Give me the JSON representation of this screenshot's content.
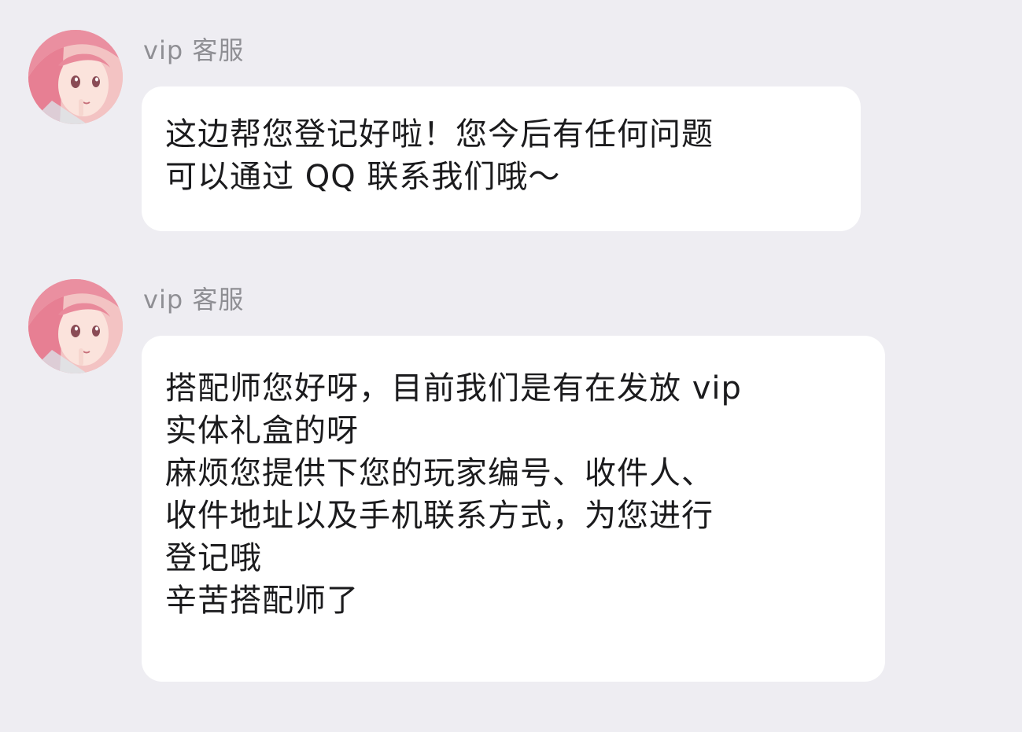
{
  "messages": [
    {
      "sender": "vip 客服",
      "lines": [
        "这边帮您登记好啦！您今后有任何问题",
        "可以通过 QQ 联系我们哦～"
      ]
    },
    {
      "sender": "vip 客服",
      "lines": [
        "搭配师您好呀，目前我们是有在发放 vip",
        "实体礼盒的呀",
        "麻烦您提供下您的玩家编号、收件人、",
        "收件地址以及手机联系方式，为您进行",
        "登记哦",
        "辛苦搭配师了"
      ]
    }
  ]
}
